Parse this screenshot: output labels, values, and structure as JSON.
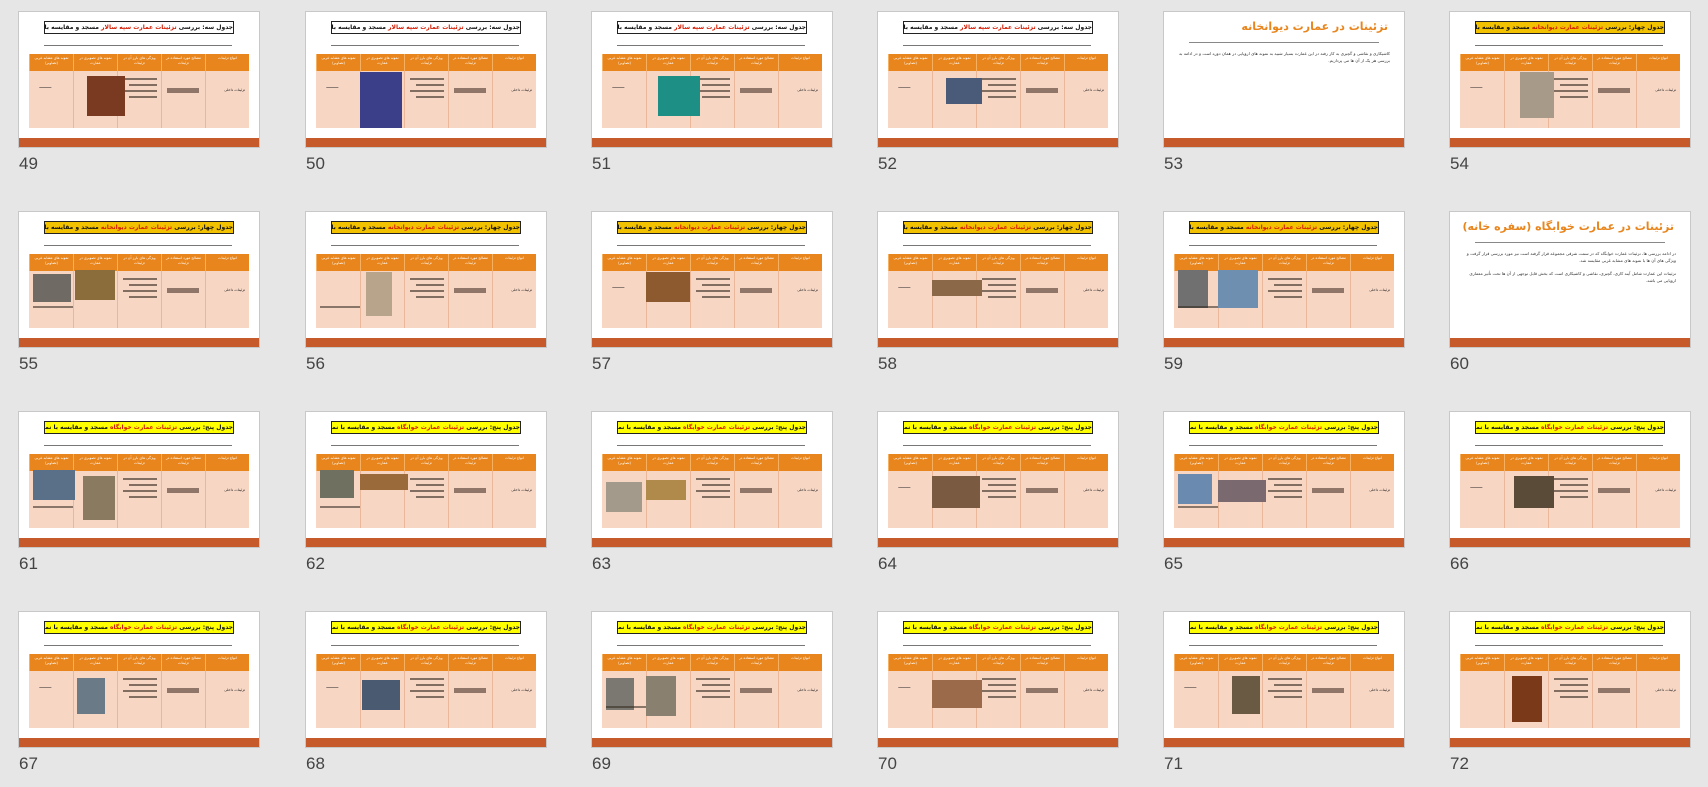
{
  "title_pre_3": "جدول سه: بررسی",
  "title_pre_4": "جدول چهار: بررسی",
  "title_pre_5": "جدول پنج: بررسی",
  "title_hl_sepahsalar": "تزئینات عمارت سپه سالار",
  "title_hl_divankhaneh": "تزئینات عمارت دیوانخانه",
  "title_hl_khabgah": "تزئینات عمارت خوابگاه",
  "title_post": "مسجد و مقایسه با نمونه های مشابه غربی",
  "headers": [
    "انواع تزئینات",
    "مصالح مورد استفاده در تزئینات",
    "ویژگی های بارز آن در تزئینات",
    "نمونه های تصویری در عمارت",
    "نمونه های مشابه غربی (تصاویر)"
  ],
  "row_type": "تزئینات داخلی",
  "dash_text": "----------",
  "section_53": {
    "title": "تزئینات در عمارت دیوانخانه",
    "body": "کاشیکاری و نقاشی و گچبری به کار رفته در این عمارت بسیار شبیه به نمونه های اروپایی در همان دوره است و در ادامه به بررسی هر یک از آن ها می پردازیم."
  },
  "section_60": {
    "title": "تزئینات در عمارت خوابگاه (سفره خانه)",
    "body_1": "در ادامه بررسی ها، تزئینات عمارت خوابگاه که در سمت شرقی مجموعه قرار گرفته است نیز مورد بررسی قرار گرفت و ویژگی های آن ها با نمونه های مشابه غربی مقایسه شد.",
    "body_2": "تزئینات این عمارت شامل آینه کاری، گچبری، نقاشی و کاشیکاری است که بخش قابل توجهی از آن ها تحت تأثیر معماری اروپایی می باشد."
  },
  "slides": [
    {
      "num": "49"
    },
    {
      "num": "50"
    },
    {
      "num": "51"
    },
    {
      "num": "52"
    },
    {
      "num": "53"
    },
    {
      "num": "54"
    },
    {
      "num": "55"
    },
    {
      "num": "56"
    },
    {
      "num": "57"
    },
    {
      "num": "58"
    },
    {
      "num": "59"
    },
    {
      "num": "60"
    },
    {
      "num": "61"
    },
    {
      "num": "62"
    },
    {
      "num": "63"
    },
    {
      "num": "64"
    },
    {
      "num": "65"
    },
    {
      "num": "66"
    },
    {
      "num": "67"
    },
    {
      "num": "68"
    },
    {
      "num": "69"
    },
    {
      "num": "70"
    },
    {
      "num": "71"
    },
    {
      "num": "72"
    }
  ],
  "colors": {
    "background": "#e6e6e6",
    "footer": "#c65a2b",
    "table_header": "#e8851c",
    "table_body": "#f7d6c4",
    "title_gold": "#f2c200",
    "title_yellow": "#ffff00",
    "highlight": "#d41a00"
  }
}
